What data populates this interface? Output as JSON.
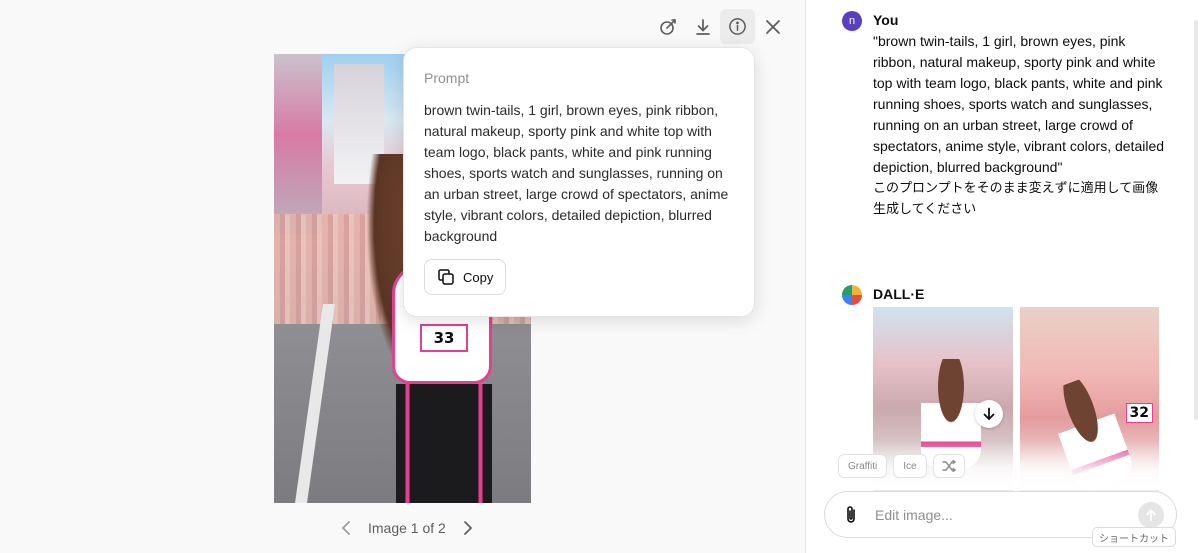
{
  "viewer": {
    "toolbar": {
      "edit_icon": "brush-edit-icon",
      "download_icon": "download-icon",
      "info_icon": "info-icon",
      "close_icon": "close-icon"
    },
    "main_image_bib": "33",
    "pager": {
      "label": "Image 1 of 2"
    }
  },
  "popover": {
    "label": "Prompt",
    "text": "brown twin-tails, 1 girl, brown eyes, pink ribbon, natural makeup, sporty pink and white top with team logo, black pants, white and pink running shoes, sports watch and sunglasses, running on an urban street, large crowd of spectators, anime style, vibrant colors, detailed depiction, blurred background",
    "copy_label": "Copy"
  },
  "chat": {
    "user": {
      "avatar_letter": "n",
      "name": "You",
      "message": "\"brown twin-tails, 1 girl, brown eyes, pink ribbon, natural makeup, sporty pink and white top with team logo, black pants, white and pink running shoes, sports watch and sunglasses, running on an urban street, large crowd of spectators, anime style, vibrant colors, detailed depiction, blurred background\"",
      "message_jp": "このプロンプトをそのまま変えずに適用して画像生成してください"
    },
    "assistant": {
      "name": "DALL·E",
      "thumb2_bib": "32"
    },
    "style_chips": [
      "Graffiti",
      "Ice"
    ],
    "shuffle_icon": "shuffle-icon",
    "composer": {
      "placeholder": "Edit image...",
      "attach_icon": "paperclip-icon",
      "send_icon": "arrow-up-icon"
    },
    "shortcut_label": "ショートカット"
  }
}
